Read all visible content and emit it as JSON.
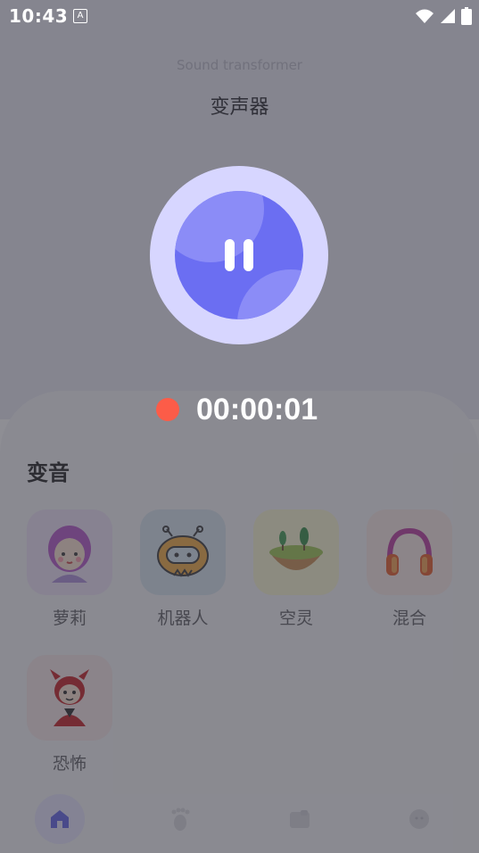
{
  "status_bar": {
    "time": "10:43",
    "notification_letter": "A"
  },
  "header": {
    "subtitle": "Sound transformer",
    "title": "变声器"
  },
  "recorder": {
    "state": "paused-button",
    "elapsed": "00:00:01"
  },
  "section": {
    "title": "变音",
    "effects": [
      {
        "label": "萝莉",
        "icon": "loli-girl-icon",
        "card_color": "#efe2f7"
      },
      {
        "label": "机器人",
        "icon": "robot-icon",
        "card_color": "#d6e4ef"
      },
      {
        "label": "空灵",
        "icon": "ethereal-landscape-icon",
        "card_color": "#fbf7cf"
      },
      {
        "label": "混合",
        "icon": "headphones-icon",
        "card_color": "#fbe9e4"
      },
      {
        "label": "恐怖",
        "icon": "devil-icon",
        "card_color": "#f7e6e7"
      }
    ]
  },
  "tabs": [
    {
      "icon": "home-icon",
      "active": true
    },
    {
      "icon": "footprint-icon",
      "active": false
    },
    {
      "icon": "folder-icon",
      "active": false
    },
    {
      "icon": "profile-icon",
      "active": false
    }
  ],
  "colors": {
    "accent": "#6b6ef2",
    "record": "#fc5c48",
    "overlay": "rgba(60,60,70,0.58)"
  }
}
